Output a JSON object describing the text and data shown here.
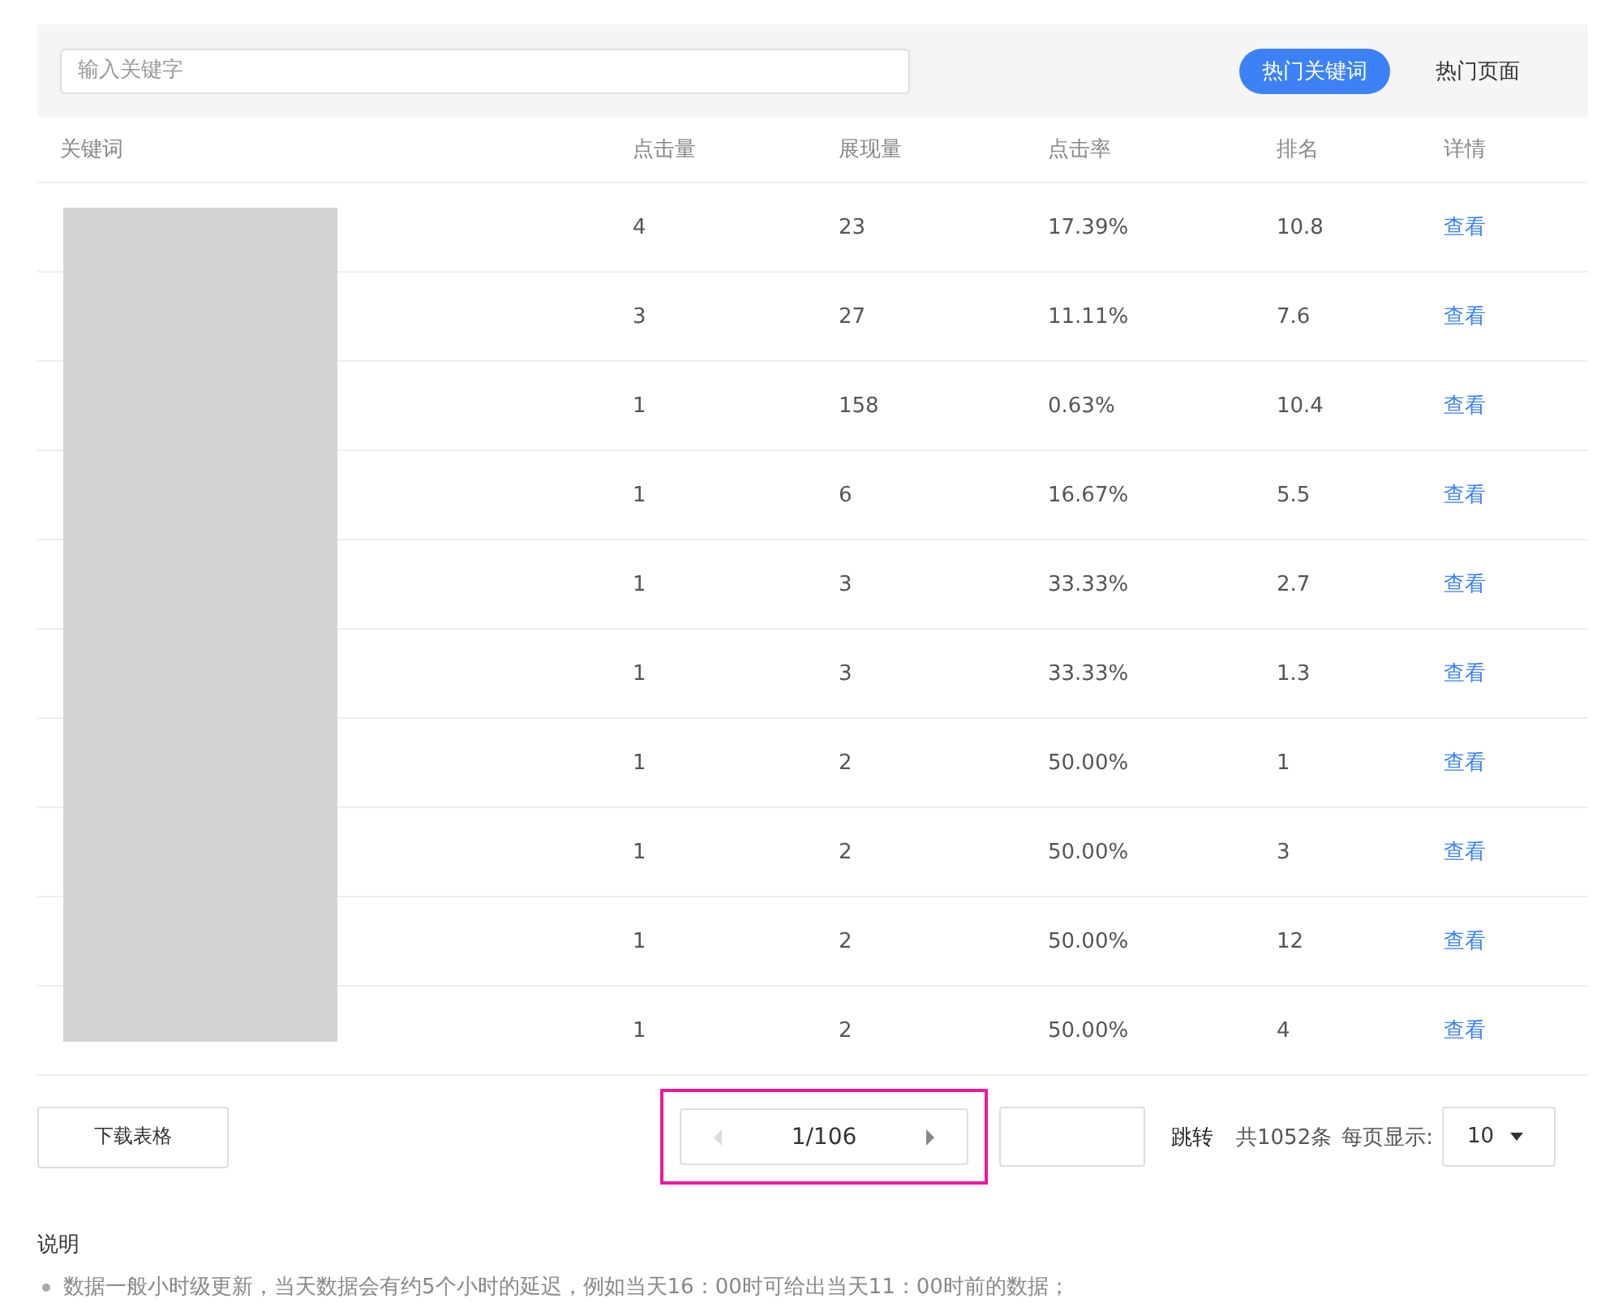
{
  "search": {
    "placeholder": "输入关键字"
  },
  "tabs": [
    {
      "label": "热门关键词",
      "selected": true
    },
    {
      "label": "热门页面",
      "selected": false
    }
  ],
  "table": {
    "columns": [
      "关键词",
      "点击量",
      "展现量",
      "点击率",
      "排名",
      "详情"
    ],
    "rows": [
      {
        "clicks": "4",
        "impressions": "23",
        "ctr": "17.39%",
        "rank": "10.8",
        "detail": "查看"
      },
      {
        "clicks": "3",
        "impressions": "27",
        "ctr": "11.11%",
        "rank": "7.6",
        "detail": "查看"
      },
      {
        "clicks": "1",
        "impressions": "158",
        "ctr": "0.63%",
        "rank": "10.4",
        "detail": "查看"
      },
      {
        "clicks": "1",
        "impressions": "6",
        "ctr": "16.67%",
        "rank": "5.5",
        "detail": "查看"
      },
      {
        "clicks": "1",
        "impressions": "3",
        "ctr": "33.33%",
        "rank": "2.7",
        "detail": "查看"
      },
      {
        "clicks": "1",
        "impressions": "3",
        "ctr": "33.33%",
        "rank": "1.3",
        "detail": "查看"
      },
      {
        "clicks": "1",
        "impressions": "2",
        "ctr": "50.00%",
        "rank": "1",
        "detail": "查看"
      },
      {
        "clicks": "1",
        "impressions": "2",
        "ctr": "50.00%",
        "rank": "3",
        "detail": "查看"
      },
      {
        "clicks": "1",
        "impressions": "2",
        "ctr": "50.00%",
        "rank": "12",
        "detail": "查看"
      },
      {
        "clicks": "1",
        "impressions": "2",
        "ctr": "50.00%",
        "rank": "4",
        "detail": "查看"
      }
    ]
  },
  "footer": {
    "download": "下载表格",
    "page": "1/106",
    "jump": "跳转",
    "total": "共1052条",
    "per_page_label": "每页显示:",
    "per_page": "10"
  },
  "notes": {
    "title": "说明",
    "items": [
      "数据一般小时级更新，当天数据会有约5个小时的延迟，例如当天16：00时可给出当天11：00时前的数据；"
    ]
  }
}
